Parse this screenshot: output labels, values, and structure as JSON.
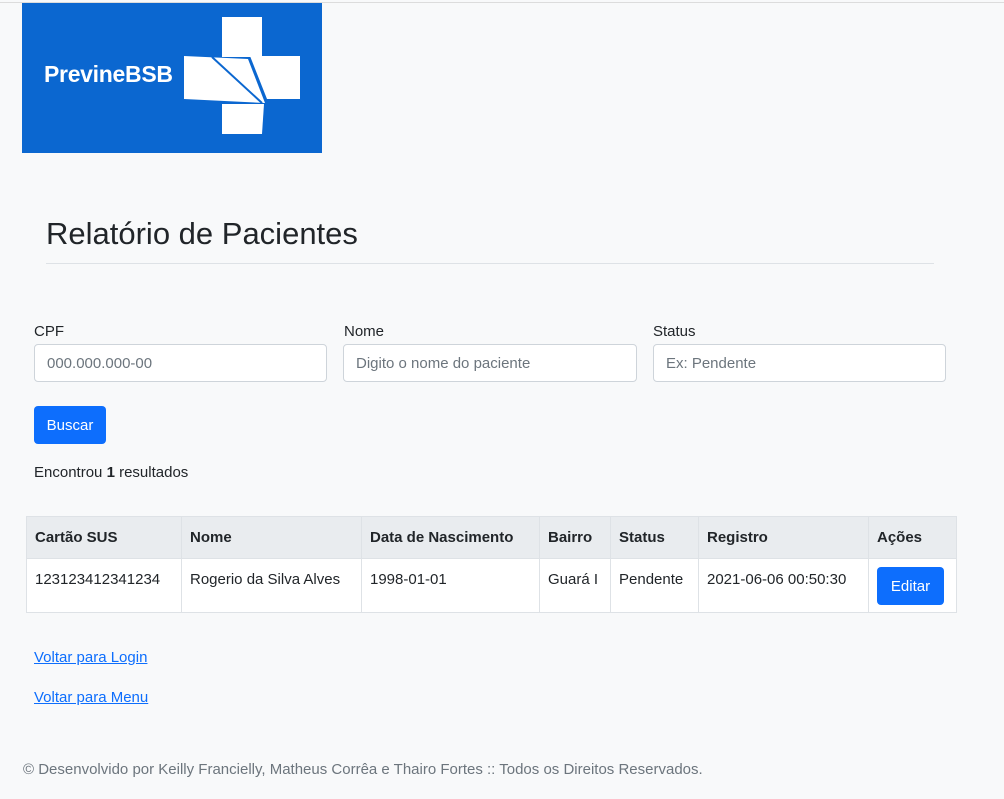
{
  "logo": {
    "text": "PrevineBSB",
    "color": "#0b67d0"
  },
  "page": {
    "title": "Relatório de Pacientes"
  },
  "filters": {
    "cpf": {
      "label": "CPF",
      "placeholder": "000.000.000-00",
      "value": ""
    },
    "nome": {
      "label": "Nome",
      "placeholder": "Digito o nome do paciente",
      "value": ""
    },
    "status": {
      "label": "Status",
      "placeholder": "Ex: Pendente",
      "value": ""
    },
    "search_label": "Buscar"
  },
  "results": {
    "prefix": "Encontrou",
    "count": "1",
    "suffix": "resultados"
  },
  "table": {
    "headers": {
      "cartao": "Cartão SUS",
      "nome": "Nome",
      "nascimento": "Data de Nascimento",
      "bairro": "Bairro",
      "status": "Status",
      "registro": "Registro",
      "acoes": "Ações"
    },
    "rows": [
      {
        "cartao": "123123412341234",
        "nome": "Rogerio da Silva Alves",
        "nascimento": "1998-01-01",
        "bairro": "Guará I",
        "status": "Pendente",
        "registro": "2021-06-06 00:50:30",
        "action_label": "Editar"
      }
    ]
  },
  "links": {
    "login": "Voltar para Login",
    "menu": "Voltar para Menu"
  },
  "footer": {
    "text": "© Desenvolvido por Keilly Francielly, Matheus Corrêa e Thairo Fortes :: Todos os Direitos Reservados."
  },
  "colors": {
    "primary": "#0d6efd",
    "background": "#f8f9fa",
    "table_header": "#e9ecef"
  }
}
